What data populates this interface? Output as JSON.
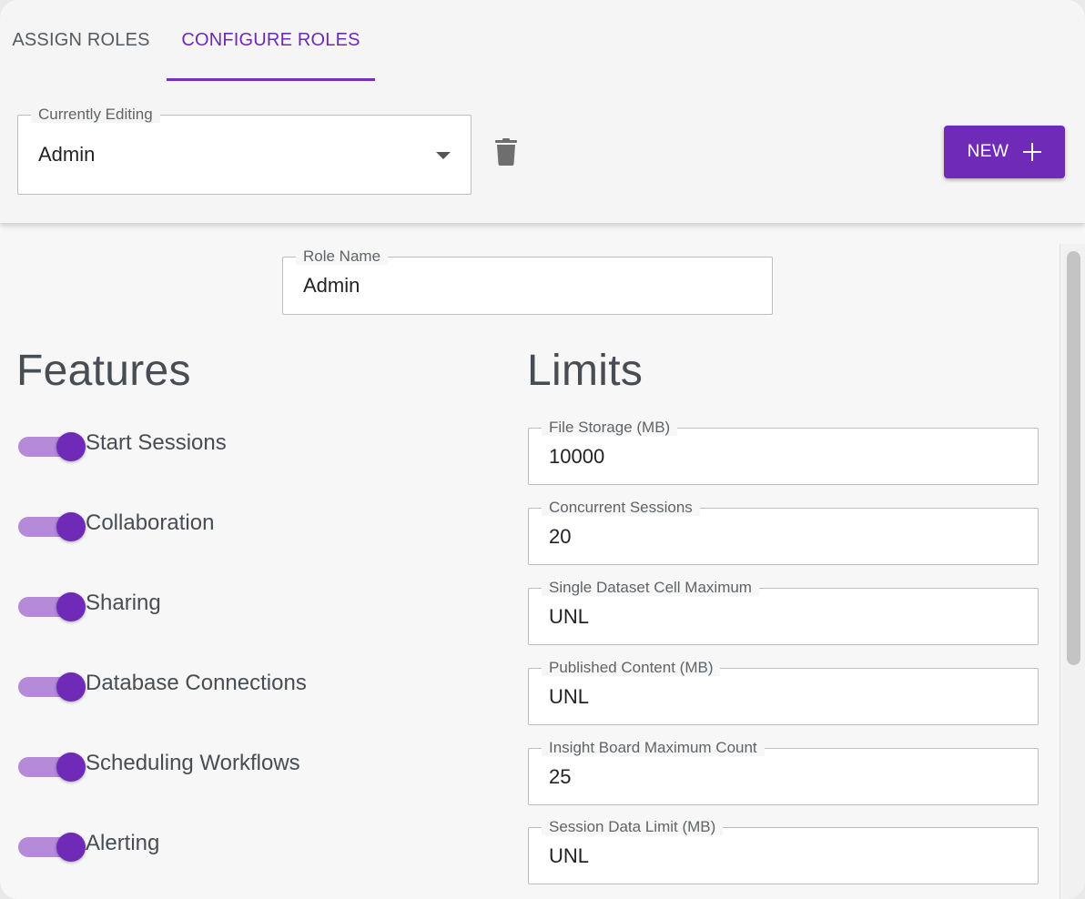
{
  "tabs": [
    {
      "label": "ASSIGN ROLES"
    },
    {
      "label": "CONFIGURE ROLES",
      "active": true
    }
  ],
  "editing": {
    "label": "Currently Editing",
    "value": "Admin"
  },
  "new_button": {
    "label": "NEW",
    "icon": "plus-icon"
  },
  "delete_icon": "trash-icon",
  "role_name": {
    "label": "Role Name",
    "value": "Admin"
  },
  "features": {
    "title": "Features",
    "items": [
      {
        "label": "Start Sessions",
        "enabled": true
      },
      {
        "label": "Collaboration",
        "enabled": true
      },
      {
        "label": "Sharing",
        "enabled": true
      },
      {
        "label": "Database Connections",
        "enabled": true
      },
      {
        "label": "Scheduling Workflows",
        "enabled": true
      },
      {
        "label": "Alerting",
        "enabled": true
      }
    ]
  },
  "limits": {
    "title": "Limits",
    "items": [
      {
        "label": "File Storage (MB)",
        "value": "10000"
      },
      {
        "label": "Concurrent Sessions",
        "value": "20"
      },
      {
        "label": "Single Dataset Cell Maximum",
        "value": "UNL"
      },
      {
        "label": "Published Content (MB)",
        "value": "UNL"
      },
      {
        "label": "Insight Board Maximum Count",
        "value": "25"
      },
      {
        "label": "Session Data Limit (MB)",
        "value": "UNL"
      }
    ]
  },
  "colors": {
    "accent": "#6f2ab8",
    "accent_light": "#b48ad9",
    "tab_active": "#6c2bb3"
  }
}
